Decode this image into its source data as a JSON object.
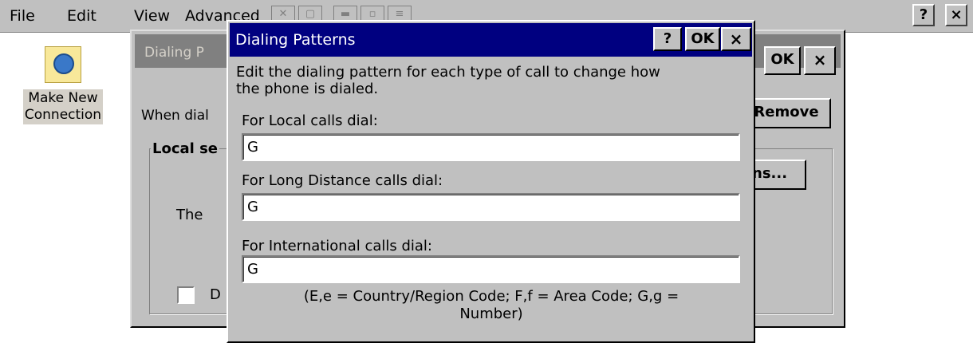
{
  "menubar": {
    "file": "File",
    "edit": "Edit",
    "view_partial": "View",
    "advanced_partial": "Advanced",
    "help_button": "?",
    "close_button": "×"
  },
  "desktop_icon": {
    "line1": "Make New",
    "line2": "Connection"
  },
  "background_dialog": {
    "title_partial": "Dialing P",
    "when_partial": "When dial",
    "local_partial": "Local se",
    "the_partial": "The",
    "checkbox_partial": "D",
    "ok_button": "OK",
    "close_button": "×",
    "remove_button": "Remove",
    "patterns_partial": "ns..."
  },
  "dialog": {
    "title": "Dialing Patterns",
    "help_button": "?",
    "ok_button": "OK",
    "close_button": "×",
    "instruction_line1": "Edit the dialing pattern for each type of call to change how",
    "instruction_line2": "the phone is dialed.",
    "local": {
      "label": "For Local calls dial:",
      "value": "G"
    },
    "long_distance": {
      "label": "For Long Distance calls dial:",
      "value": "G"
    },
    "international": {
      "label": "For International calls dial:",
      "value": "G"
    },
    "legend_line1": "(E,e = Country/Region Code; F,f = Area Code; G,g =",
    "legend_line2": "Number)"
  }
}
